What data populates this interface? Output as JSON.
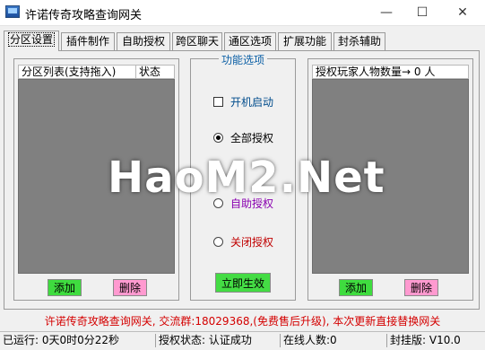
{
  "window": {
    "title": "许诺传奇攻略查询网关",
    "minimize_glyph": "—",
    "maximize_glyph": "☐",
    "close_glyph": "✕"
  },
  "tabs": [
    {
      "label": "分区设置",
      "active": true
    },
    {
      "label": "插件制作"
    },
    {
      "label": "自助授权"
    },
    {
      "label": "跨区聊天"
    },
    {
      "label": "通区选项"
    },
    {
      "label": "扩展功能"
    },
    {
      "label": "封杀辅助"
    }
  ],
  "left_panel": {
    "columns": [
      "分区列表(支持拖入)",
      "状态"
    ],
    "add_label": "添加",
    "delete_label": "删除"
  },
  "middle_panel": {
    "legend": "功能选项",
    "options": [
      {
        "label": "开机启动",
        "type": "checkbox",
        "checked": false,
        "color": "#004c8c"
      },
      {
        "label": "全部授权",
        "type": "radio",
        "checked": true,
        "color": "#000000"
      },
      {
        "label": "自助授权",
        "type": "radio",
        "checked": false,
        "color": "#8a00b0"
      },
      {
        "label": "关闭授权",
        "type": "radio",
        "checked": false,
        "color": "#c00000"
      }
    ],
    "apply_label": "立即生效"
  },
  "right_panel": {
    "header": "授权玩家人物数量→ 0 人",
    "add_label": "添加",
    "delete_label": "删除"
  },
  "footer_note": "许诺传奇攻略查询网关, 交流群:18029368,(免费售后升级), 本次更新直接替换网关",
  "status_bar": {
    "uptime": "已运行: 0天0时0分22秒",
    "auth_status": "授权状态: 认证成功",
    "online": "在线人数:0",
    "version": "封挂版: V10.0"
  },
  "watermark": "HaoM2.Net"
}
